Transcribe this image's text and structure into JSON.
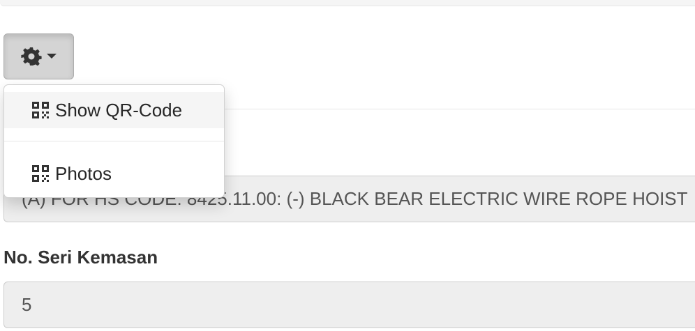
{
  "toolbar": {
    "menu_button_icon": "gear-icon",
    "caret_icon": "caret-down-icon"
  },
  "dropdown": {
    "items": [
      {
        "label": "Show QR-Code",
        "icon": "qrcode-icon"
      },
      {
        "label": "Photos",
        "icon": "qrcode-icon"
      }
    ]
  },
  "form": {
    "description_value": "(A) FOR HS CODE: 8425.11.00:  (-) BLACK BEAR ELECTRIC WIRE ROPE HOIST",
    "seri_label": "No. Seri Kemasan",
    "seri_value": "5"
  },
  "colors": {
    "button_active_bg": "#d4d4d4",
    "readonly_field_bg": "#eeeeee",
    "menu_hover_bg": "#f5f5f5"
  }
}
